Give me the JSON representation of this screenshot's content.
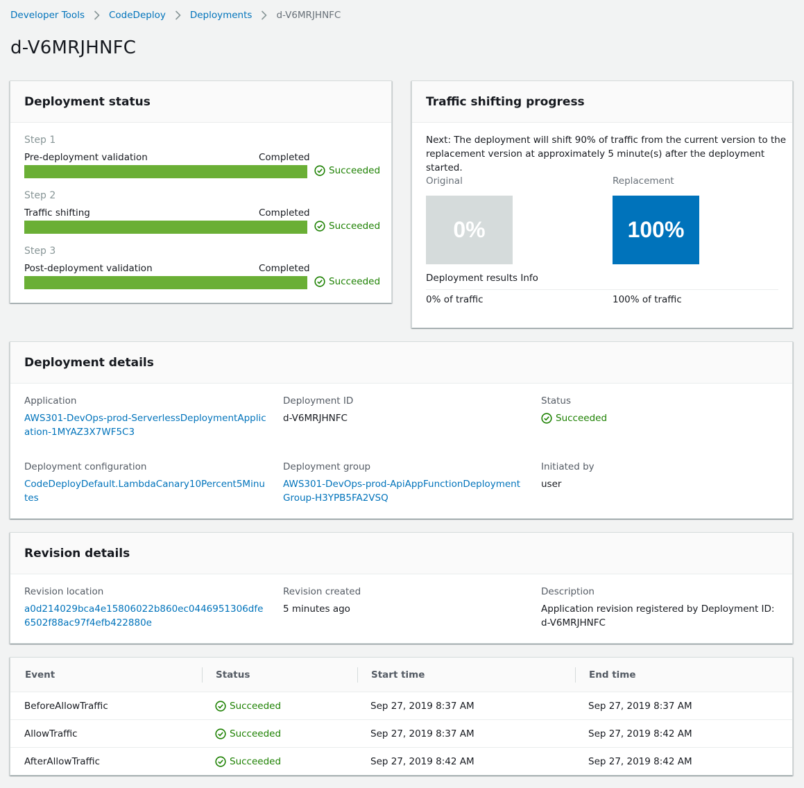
{
  "breadcrumb": {
    "items": [
      "Developer Tools",
      "CodeDeploy",
      "Deployments"
    ],
    "current": "d-V6MRJHNFC"
  },
  "page_title": "d-V6MRJHNFC",
  "deployment_status": {
    "title": "Deployment status",
    "steps": [
      {
        "step": "Step 1",
        "name": "Pre-deployment validation",
        "state": "Completed",
        "result": "Succeeded",
        "progress": 1.0
      },
      {
        "step": "Step 2",
        "name": "Traffic shifting",
        "state": "Completed",
        "result": "Succeeded",
        "progress": 1.0
      },
      {
        "step": "Step 3",
        "name": "Post-deployment validation",
        "state": "Completed",
        "result": "Succeeded",
        "progress": 1.0
      }
    ]
  },
  "traffic": {
    "title": "Traffic shifting progress",
    "next_text": "Next: The deployment will shift 90% of traffic from the current version to the replacement version at approximately 5 minute(s) after the deployment started.",
    "original_label": "Original",
    "replacement_label": "Replacement",
    "original_value": "0%",
    "replacement_value": "100%",
    "results_label": "Deployment results Info",
    "original_traffic": "0% of traffic",
    "replacement_traffic": "100% of traffic"
  },
  "details": {
    "title": "Deployment details",
    "application_label": "Application",
    "application_value": "AWS301-DevOps-prod-ServerlessDeploymentApplication-1MYAZ3X7WF5C3",
    "deployment_id_label": "Deployment ID",
    "deployment_id_value": "d-V6MRJHNFC",
    "status_label": "Status",
    "status_value": "Succeeded",
    "config_label": "Deployment configuration",
    "config_value": "CodeDeployDefault.LambdaCanary10Percent5Minutes",
    "group_label": "Deployment group",
    "group_value": "AWS301-DevOps-prod-ApiAppFunctionDeploymentGroup-H3YPB5FA2VSQ",
    "initiated_label": "Initiated by",
    "initiated_value": "user"
  },
  "revision": {
    "title": "Revision details",
    "location_label": "Revision location",
    "location_value": "a0d214029bca4e15806022b860ec0446951306dfe6502f88ac97f4efb422880e",
    "created_label": "Revision created",
    "created_value": "5 minutes ago",
    "description_label": "Description",
    "description_value": "Application revision registered by Deployment ID: d-V6MRJHNFC"
  },
  "events": {
    "columns": [
      "Event",
      "Status",
      "Start time",
      "End time"
    ],
    "rows": [
      {
        "event": "BeforeAllowTraffic",
        "status": "Succeeded",
        "start": "Sep 27, 2019 8:37 AM",
        "end": "Sep 27, 2019 8:37 AM"
      },
      {
        "event": "AllowTraffic",
        "status": "Succeeded",
        "start": "Sep 27, 2019 8:37 AM",
        "end": "Sep 27, 2019 8:42 AM"
      },
      {
        "event": "AfterAllowTraffic",
        "status": "Succeeded",
        "start": "Sep 27, 2019 8:42 AM",
        "end": "Sep 27, 2019 8:42 AM"
      }
    ]
  },
  "colors": {
    "link": "#0073bb",
    "success": "#1d8102",
    "progress_bar": "#6aaf35",
    "replacement_box": "#0073bb",
    "original_box": "#d5dbdb"
  }
}
